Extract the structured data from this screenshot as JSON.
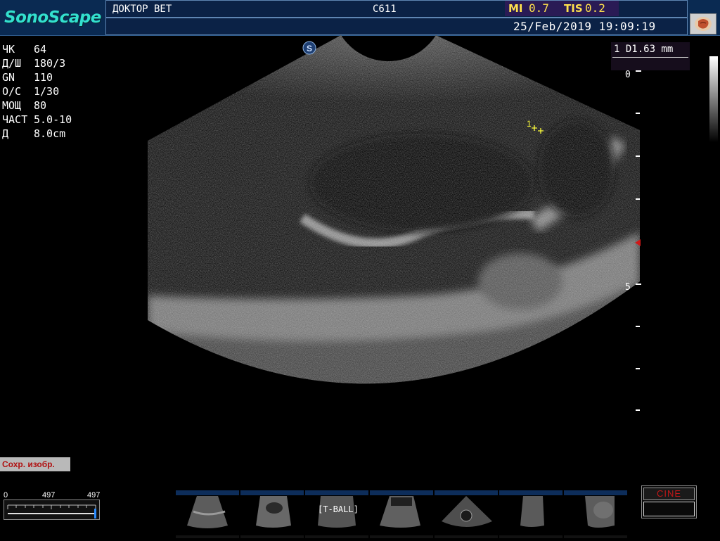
{
  "header": {
    "logo": "SonoScape",
    "patient_name": "ДОКТОР ВЕТ",
    "probe": "C611",
    "mi_label": "MI",
    "mi_value": "0.7",
    "tis_label": "TIS",
    "tis_value": "0.2",
    "datetime": "25/Feb/2019 19:09:19",
    "exam_icon": "abdomen-organ-icon"
  },
  "params": [
    {
      "label": "ЧК",
      "value": " 64"
    },
    {
      "label": "Д/Ш",
      "value": "180/3"
    },
    {
      "label": "GN",
      "value": "110"
    },
    {
      "label": "O/C",
      "value": "1/30"
    },
    {
      "label": "МОЩ",
      "value": "80"
    },
    {
      "label": "ЧАСТ",
      "value": "5.0-10"
    },
    {
      "label": "Д",
      "value": "8.0cm"
    }
  ],
  "measurement": {
    "text": "1 D1.63 mm",
    "caliper_label": "1"
  },
  "depth_scale": {
    "label_top": "0",
    "label_mid": "5"
  },
  "save_button": "Сохр. изобр.",
  "cine": {
    "min": "0",
    "mid": "497",
    "max": "497",
    "position_fraction": 1.0,
    "panel_label": "CINE"
  },
  "thumbnails": {
    "overlay_label": "[T-BALL]",
    "count": 7
  },
  "colors": {
    "header_bg": "#0a2a52",
    "logo": "#33e0cf",
    "mi_text": "#ffe14d",
    "cine_label": "#c21818",
    "save_text": "#b01010",
    "caliper": "#ffff3a"
  }
}
